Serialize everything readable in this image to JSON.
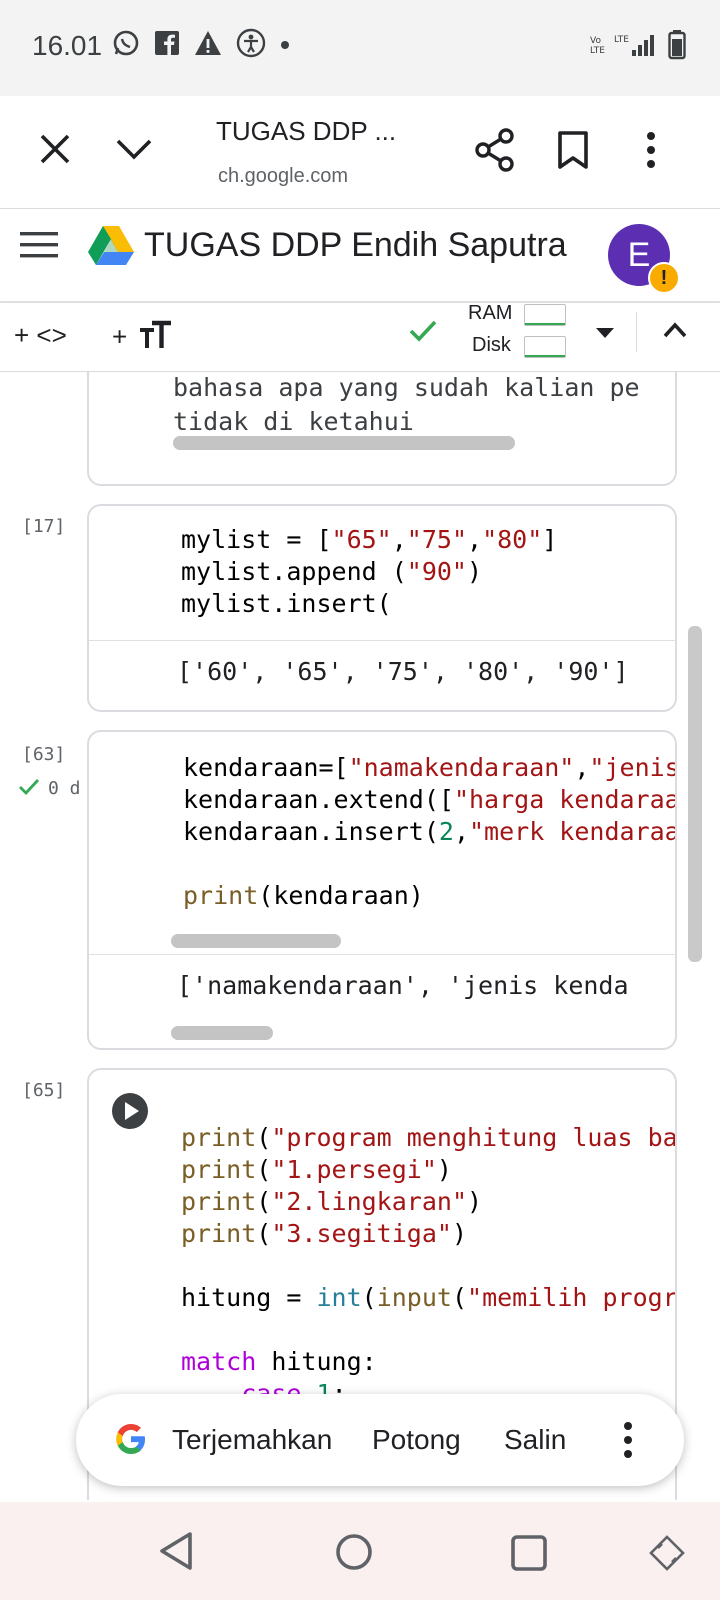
{
  "status_bar": {
    "time": "16.01",
    "icons": [
      "whatsapp-icon",
      "facebook-icon",
      "warning-icon",
      "accessibility-icon",
      "dot-icon"
    ],
    "right_icons": [
      "volte-icon",
      "lte-icon",
      "signal-icon",
      "battery-icon"
    ]
  },
  "custom_tab": {
    "title": "TUGAS DDP ...",
    "url": "ch.google.com"
  },
  "colab_header": {
    "title": "TUGAS DDP Endih Saputra",
    "avatar_letter": "E",
    "avatar_badge": "!"
  },
  "toolbar": {
    "add_code": "+ <>",
    "add_text": "+",
    "ram_label": "RAM",
    "disk_label": "Disk"
  },
  "cells": {
    "text_cell": {
      "line1": "bahasa apa yang sudah kalian pe",
      "line2": "tidak di ketahui"
    },
    "cell17": {
      "exec_count": "[17]",
      "output": "['60', '65', '75', '80', '90']"
    },
    "cell63": {
      "exec_count": "[63]",
      "exec_time": "0 d",
      "output": "['namakendaraan', 'jenis kenda"
    },
    "cell65": {
      "exec_count": "[65]"
    }
  },
  "selection_popup": {
    "translate": "Terjemahkan",
    "cut": "Potong",
    "copy": "Salin"
  },
  "colors": {
    "string": "#a31515",
    "function": "#795e26",
    "number": "#098658",
    "builtin": "#267f99",
    "control": "#af00db",
    "check": "#34a853",
    "avatar": "#5c2fb2"
  }
}
